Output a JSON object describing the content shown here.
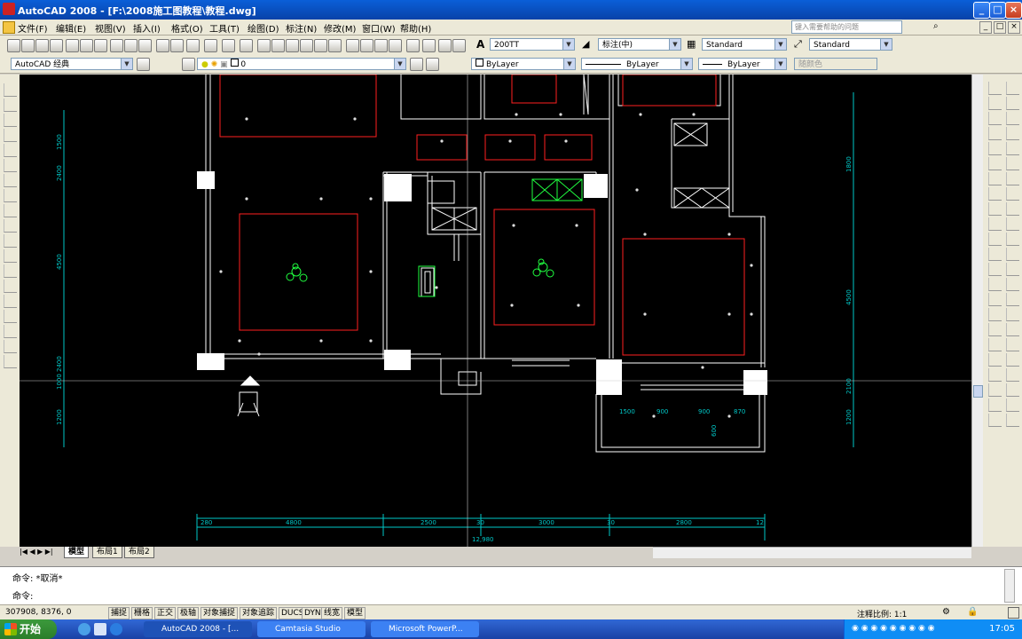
{
  "window": {
    "title": "AutoCAD 2008 - [F:\\2008施工图教程\\教程.dwg]",
    "buttons": [
      "_",
      "□",
      "×"
    ]
  },
  "menu": {
    "items": [
      "文件(F)",
      "编辑(E)",
      "视图(V)",
      "插入(I)",
      "格式(O)",
      "工具(T)",
      "绘图(D)",
      "标注(N)",
      "修改(M)",
      "窗口(W)",
      "帮助(H)"
    ],
    "search_placeholder": "键入需要帮助的问题"
  },
  "toolbar1": {
    "text_style": "200TT",
    "dim_style": "标注(中)",
    "table_style": "Standard",
    "mleader_style": "Standard"
  },
  "toolbar2": {
    "workspace": "AutoCAD 经典",
    "layer": "0",
    "color": "ByLayer",
    "linetype": "ByLayer",
    "lineweight": "ByLayer",
    "plotstyle": "随颜色"
  },
  "drawing": {
    "dims_bottom": [
      "280",
      "4800",
      "2500",
      "30",
      "3000",
      "30",
      "2800",
      "12"
    ],
    "dim_total": "12,980",
    "dims_left": [
      "2400",
      "1500",
      "4500",
      "2400",
      "1000",
      "1200"
    ],
    "dims_right": [
      "1800",
      "4500",
      "2100",
      "1200"
    ],
    "dims_balcony": [
      "1500",
      "900",
      "900",
      "870"
    ],
    "dim_balcony_v": "600",
    "colors": {
      "wall": "#ffffff",
      "ceiling": "#ff2020",
      "grid": "#00d0d0",
      "green": "#20ff40",
      "dim": "#00c8c8"
    }
  },
  "layout_tabs": [
    "模型",
    "布局1",
    "布局2"
  ],
  "command": {
    "lines": [
      "命令: *取消*",
      "命令:"
    ]
  },
  "status": {
    "coords": "307908, 8376, 0",
    "toggles": [
      "捕捉",
      "栅格",
      "正交",
      "极轴",
      "对象捕捉",
      "对象追踪",
      "DUCS",
      "DYN",
      "线宽",
      "模型"
    ],
    "annotation_scale": "注释比例: 1:1"
  },
  "taskbar": {
    "start": "开始",
    "tasks": [
      "AutoCAD 2008 - [...",
      "Camtasia Studio",
      "Microsoft PowerP..."
    ],
    "clock": "17:05"
  }
}
